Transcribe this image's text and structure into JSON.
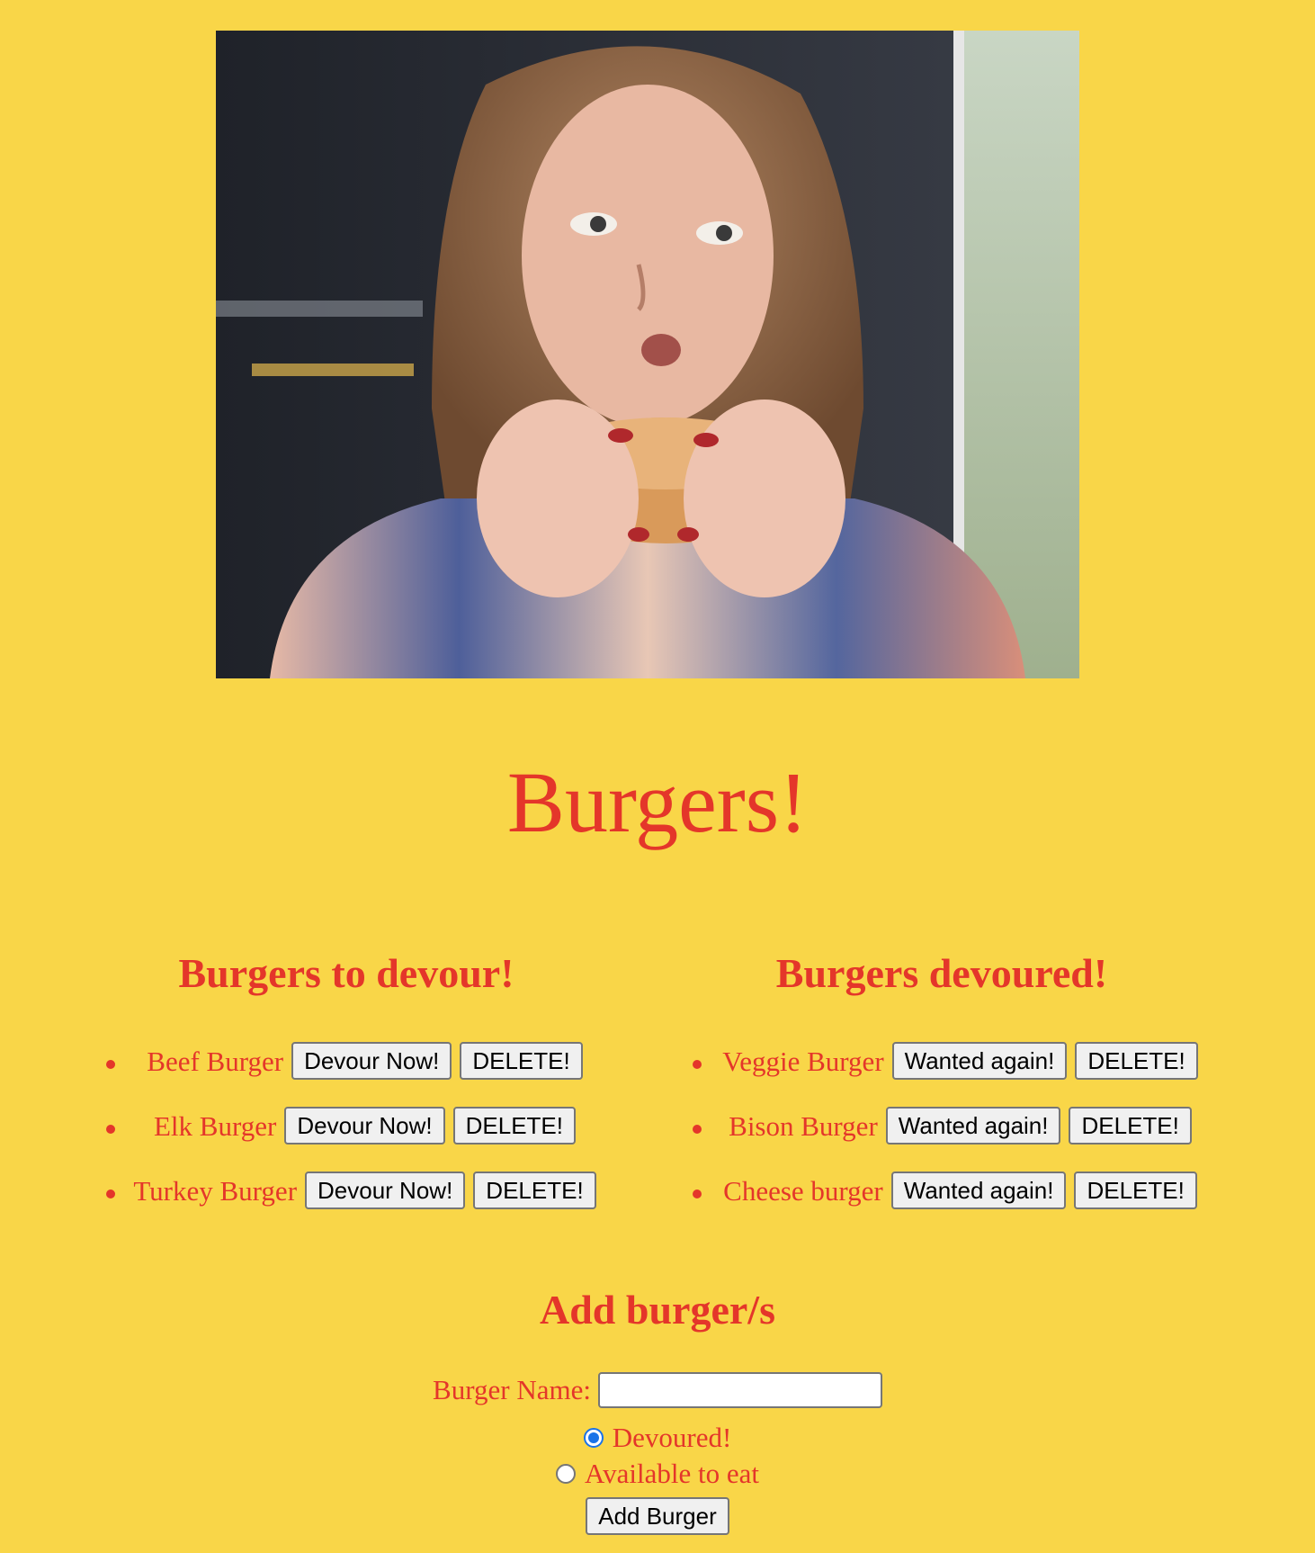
{
  "hero_image": {
    "description_icon": "person-eating-burger-photo"
  },
  "title": "Burgers!",
  "to_devour": {
    "heading": "Burgers to devour!",
    "items": [
      {
        "name": "Beef Burger",
        "action_label": "Devour Now!",
        "delete_label": "DELETE!"
      },
      {
        "name": "Elk Burger",
        "action_label": "Devour Now!",
        "delete_label": "DELETE!"
      },
      {
        "name": "Turkey Burger",
        "action_label": "Devour Now!",
        "delete_label": "DELETE!"
      }
    ]
  },
  "devoured": {
    "heading": "Burgers devoured!",
    "items": [
      {
        "name": "Veggie Burger",
        "action_label": "Wanted again!",
        "delete_label": "DELETE!"
      },
      {
        "name": "Bison Burger",
        "action_label": "Wanted again!",
        "delete_label": "DELETE!"
      },
      {
        "name": "Cheese burger",
        "action_label": "Wanted again!",
        "delete_label": "DELETE!"
      }
    ]
  },
  "add_form": {
    "heading": "Add burger/s",
    "name_label": "Burger Name:",
    "name_value": "",
    "radio_devoured_label": "Devoured!",
    "radio_devoured_checked": true,
    "radio_available_label": "Available to eat",
    "radio_available_checked": false,
    "submit_label": "Add Burger"
  },
  "colors": {
    "background": "#f9d648",
    "text": "#e4362a",
    "radio_checked": "#1a73e8"
  }
}
